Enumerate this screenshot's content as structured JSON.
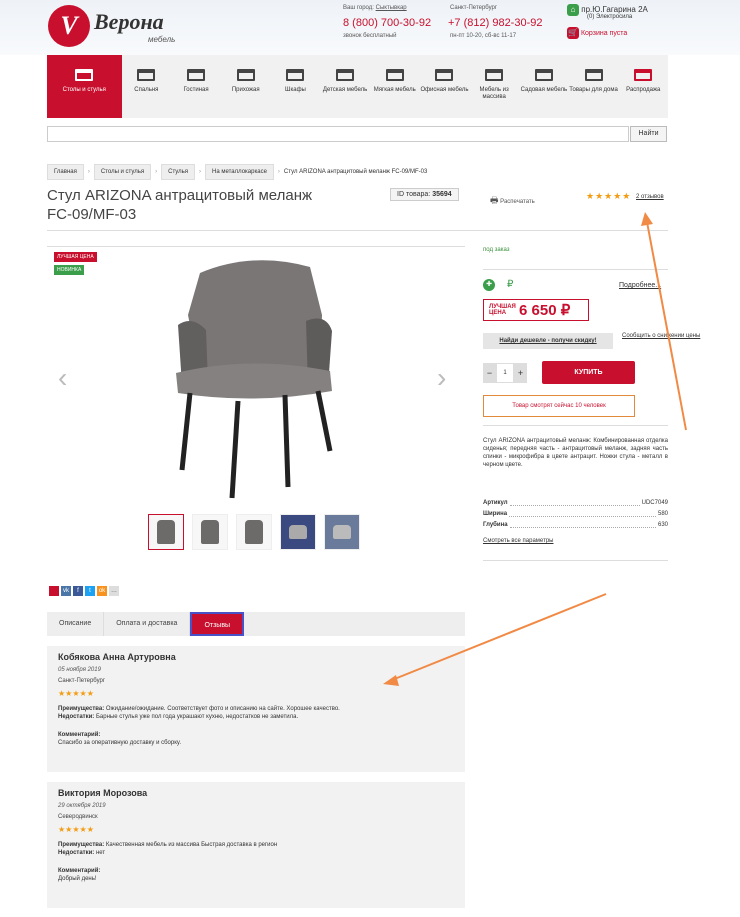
{
  "header": {
    "logo_letter": "V",
    "logo_name": "Верона",
    "logo_sub": "мебель",
    "city_label": "Ваш город:",
    "city_value": "Сыктывкар",
    "phone1": "8 (800) 700-30-92",
    "phone1_note": "звонок бесплатный",
    "region_label": "Санкт-Петербург",
    "phone2": "+7 (812) 982-30-92",
    "phone2_note": "пн-пт 10-20, сб-вс 11-17",
    "address": "пр.Ю.Гагарина 2А",
    "address_note": "(0) Электросила",
    "cart": "Корзина пуста"
  },
  "menu": [
    "Столы и стулья",
    "Спальня",
    "Гостиная",
    "Прихожая",
    "Шкафы",
    "Детская мебель",
    "Мягкая мебель",
    "Офисная мебель",
    "Мебель из массива",
    "Садовая мебель",
    "Товары для дома",
    "Распродажа"
  ],
  "search": {
    "placeholder": "",
    "button": "Найти"
  },
  "breadcrumbs": [
    "Главная",
    "Столы и стулья",
    "Стулья",
    "На металлокаркасе",
    "Стул ARIZONA антрацитовый меланж FC-09/MF-03"
  ],
  "product": {
    "title": "Стул ARIZONA антрацитовый меланж FC-09/MF-03",
    "id_label": "ID товара:",
    "id_value": "35694",
    "print": "Распечатать",
    "rating": "★★★★★",
    "reviews_link": "2 отзывов",
    "badge_best": "ЛУЧШАЯ ЦЕНА",
    "badge_new": "НОВИНКА",
    "availability": "под заказ",
    "rub_sign": "₽",
    "more": "Подробнее...",
    "price_label": "ЛУЧШАЯ ЦЕНА",
    "price": "6 650 ₽",
    "cheaper": "Найди дешевле - получи скидку!",
    "notify": "Сообщить о снижении цены",
    "qty": "1",
    "minus": "−",
    "plus": "+",
    "buy": "КУПИТЬ",
    "watching": "Товар смотрят сейчас 10 человек",
    "description": "Стул ARIZONA антрацитовый меланж: Комбинированная отделка сиденья; передняя часть - антрацитовый меланж, задняя часть спинки - микрофибра в цвете антрацит. Ножки стула - металл в черном цвете.",
    "specs": [
      {
        "k": "Артикул",
        "v": "UDC7049"
      },
      {
        "k": "Ширина",
        "v": "580"
      },
      {
        "k": "Глубина",
        "v": "630"
      }
    ],
    "all_params": "Смотреть все параметры"
  },
  "social": [
    "",
    "vk",
    "f",
    "t",
    "ok",
    "…"
  ],
  "tabs": [
    "Описание",
    "Оплата и доставка",
    "Отзывы"
  ],
  "reviews": [
    {
      "name": "Кобякова Анна Артуровна",
      "date": "05 ноября 2019",
      "city": "Санкт-Петербург",
      "stars": "★★★★★",
      "pros_label": "Преимущества:",
      "pros": "Ожидание/ожидание. Соответствует фото и описанию на сайте. Хорошее качество.",
      "cons_label": "Недостатки:",
      "cons": "Барные стулья уже пол года украшают кухню, недостатков не заметила.",
      "comment_label": "Комментарий:",
      "comment": "Спасибо за оперативную доставку и сборку."
    },
    {
      "name": "Виктория Морозова",
      "date": "29 октября 2019",
      "city": "Северодвинск",
      "stars": "★★★★★",
      "pros_label": "Преимущества:",
      "pros": "Качественная мебель из массива Быстрая доставка в регион",
      "cons_label": "Недостатки:",
      "cons": "нет",
      "comment_label": "Комментарий:",
      "comment": "Добрый день!"
    }
  ],
  "colors": {
    "accent": "#c8102e",
    "annotation_arrow": "#f08a45",
    "star": "#f39c12"
  }
}
